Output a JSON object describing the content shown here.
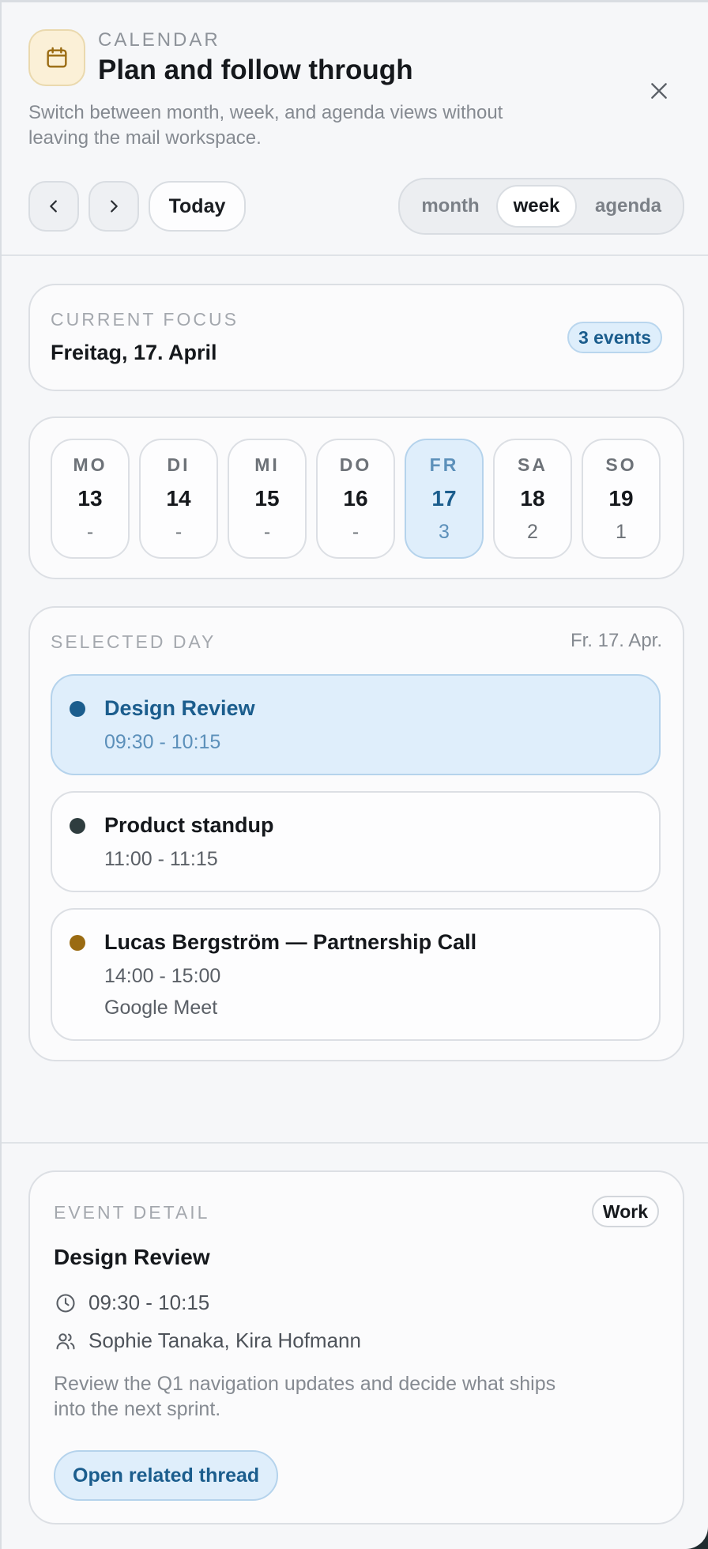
{
  "header": {
    "eyebrow": "CALENDAR",
    "title": "Plan and follow through",
    "subtitle": "Switch between month, week, and agenda views without leaving the mail workspace.",
    "today_label": "Today",
    "views": [
      "month",
      "week",
      "agenda"
    ],
    "active_view": "week"
  },
  "focus": {
    "label": "CURRENT FOCUS",
    "date": "Freitag, 17. April",
    "event_count": "3 events"
  },
  "week": {
    "days": [
      {
        "dow": "MO",
        "num": "13",
        "count": "-"
      },
      {
        "dow": "DI",
        "num": "14",
        "count": "-"
      },
      {
        "dow": "MI",
        "num": "15",
        "count": "-"
      },
      {
        "dow": "DO",
        "num": "16",
        "count": "-"
      },
      {
        "dow": "FR",
        "num": "17",
        "count": "3"
      },
      {
        "dow": "SA",
        "num": "18",
        "count": "2"
      },
      {
        "dow": "SO",
        "num": "19",
        "count": "1"
      }
    ],
    "selected_index": 4
  },
  "selected_day": {
    "label": "SELECTED DAY",
    "short_date": "Fr. 17. Apr.",
    "events": [
      {
        "title": "Design Review",
        "time": "09:30 - 10:15",
        "location": "",
        "color": "#1b5d8d"
      },
      {
        "title": "Product standup",
        "time": "11:00 - 11:15",
        "location": "",
        "color": "#2f3d3f"
      },
      {
        "title": "Lucas Bergström — Partnership Call",
        "time": "14:00 - 15:00",
        "location": "Google Meet",
        "color": "#9a6b12"
      }
    ]
  },
  "detail": {
    "label": "EVENT DETAIL",
    "tag": "Work",
    "title": "Design Review",
    "time": "09:30 - 10:15",
    "attendees": "Sophie Tanaka, Kira Hofmann",
    "description": "Review the Q1 navigation updates and decide what ships into the next sprint.",
    "action": "Open related thread"
  },
  "colors": {
    "accent": "#1b5d8d",
    "accent_bg": "#dfeefb",
    "calendar_badge_bg": "#fbf0d7",
    "calendar_icon": "#9a6b12"
  },
  "icons": {
    "calendar": "calendar-icon",
    "close": "close-icon",
    "prev": "chevron-left-icon",
    "next": "chevron-right-icon",
    "clock": "clock-icon",
    "people": "people-icon"
  }
}
